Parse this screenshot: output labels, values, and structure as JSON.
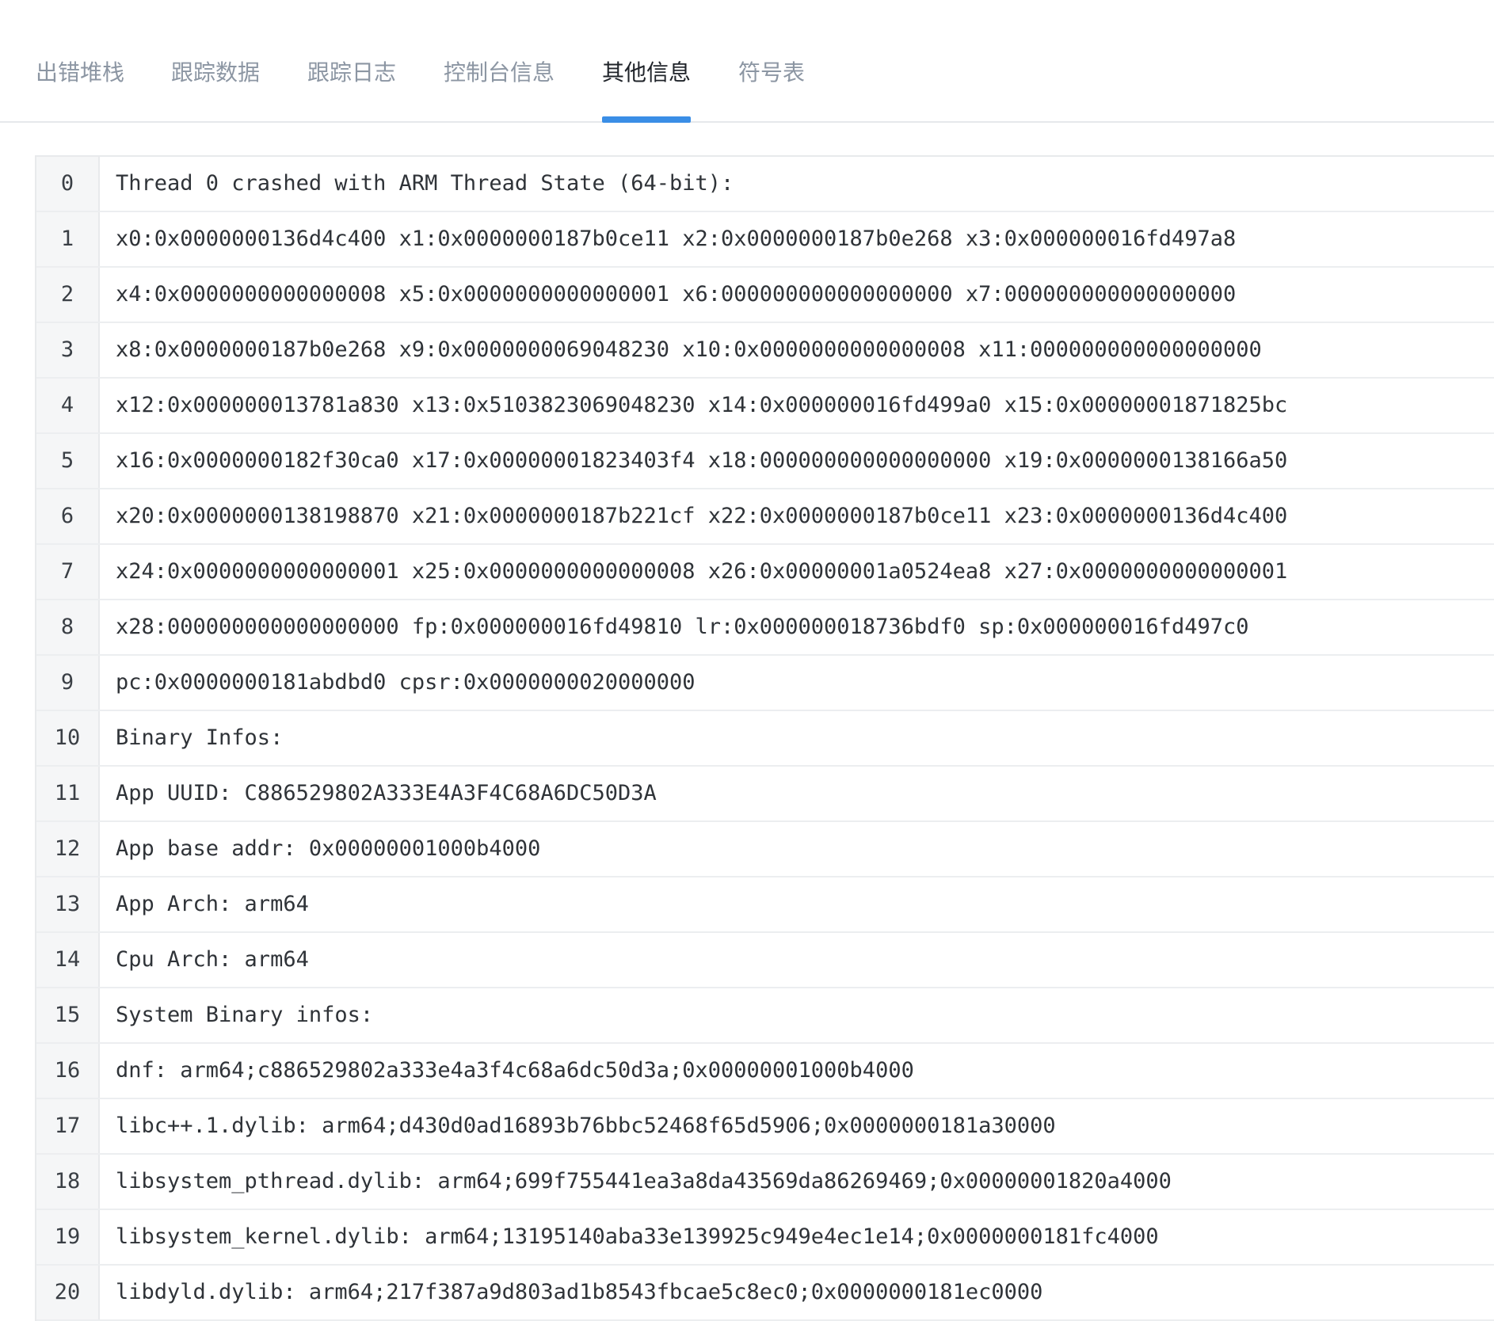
{
  "tabs": [
    {
      "label": "出错堆栈",
      "active": false
    },
    {
      "label": "跟踪数据",
      "active": false
    },
    {
      "label": "跟踪日志",
      "active": false
    },
    {
      "label": "控制台信息",
      "active": false
    },
    {
      "label": "其他信息",
      "active": true
    },
    {
      "label": "符号表",
      "active": false
    }
  ],
  "colors": {
    "active_tab_text": "#1f2329",
    "inactive_tab_text": "#8c96a3",
    "tab_indicator": "#3a8ee6",
    "line_number_bg": "#f5f6f7"
  },
  "lines": [
    {
      "no": "0",
      "text": "Thread 0 crashed with ARM Thread State (64-bit):"
    },
    {
      "no": "1",
      "text": "x0:0x0000000136d4c400 x1:0x0000000187b0ce11 x2:0x0000000187b0e268 x3:0x000000016fd497a8"
    },
    {
      "no": "2",
      "text": "x4:0x0000000000000008 x5:0x0000000000000001 x6:000000000000000000 x7:000000000000000000"
    },
    {
      "no": "3",
      "text": "x8:0x0000000187b0e268 x9:0x0000000069048230 x10:0x0000000000000008 x11:000000000000000000"
    },
    {
      "no": "4",
      "text": "x12:0x000000013781a830 x13:0x5103823069048230 x14:0x000000016fd499a0 x15:0x00000001871825bc"
    },
    {
      "no": "5",
      "text": "x16:0x0000000182f30ca0 x17:0x00000001823403f4 x18:000000000000000000 x19:0x0000000138166a50"
    },
    {
      "no": "6",
      "text": "x20:0x0000000138198870 x21:0x0000000187b221cf x22:0x0000000187b0ce11 x23:0x0000000136d4c400"
    },
    {
      "no": "7",
      "text": "x24:0x0000000000000001 x25:0x0000000000000008 x26:0x00000001a0524ea8 x27:0x0000000000000001"
    },
    {
      "no": "8",
      "text": "x28:000000000000000000 fp:0x000000016fd49810 lr:0x000000018736bdf0 sp:0x000000016fd497c0"
    },
    {
      "no": "9",
      "text": "pc:0x0000000181abdbd0 cpsr:0x0000000020000000"
    },
    {
      "no": "10",
      "text": "Binary Infos:"
    },
    {
      "no": "11",
      "text": "App UUID: C886529802A333E4A3F4C68A6DC50D3A"
    },
    {
      "no": "12",
      "text": "App base addr: 0x00000001000b4000"
    },
    {
      "no": "13",
      "text": "App Arch: arm64"
    },
    {
      "no": "14",
      "text": "Cpu Arch: arm64"
    },
    {
      "no": "15",
      "text": "System Binary infos:"
    },
    {
      "no": "16",
      "text": "dnf: arm64;c886529802a333e4a3f4c68a6dc50d3a;0x00000001000b4000"
    },
    {
      "no": "17",
      "text": "libc++.1.dylib: arm64;d430d0ad16893b76bbc52468f65d5906;0x0000000181a30000"
    },
    {
      "no": "18",
      "text": "libsystem_pthread.dylib: arm64;699f755441ea3a8da43569da86269469;0x00000001820a4000"
    },
    {
      "no": "19",
      "text": "libsystem_kernel.dylib: arm64;13195140aba33e139925c949e4ec1e14;0x0000000181fc4000"
    },
    {
      "no": "20",
      "text": "libdyld.dylib: arm64;217f387a9d803ad1b8543fbcae5c8ec0;0x0000000181ec0000"
    }
  ]
}
